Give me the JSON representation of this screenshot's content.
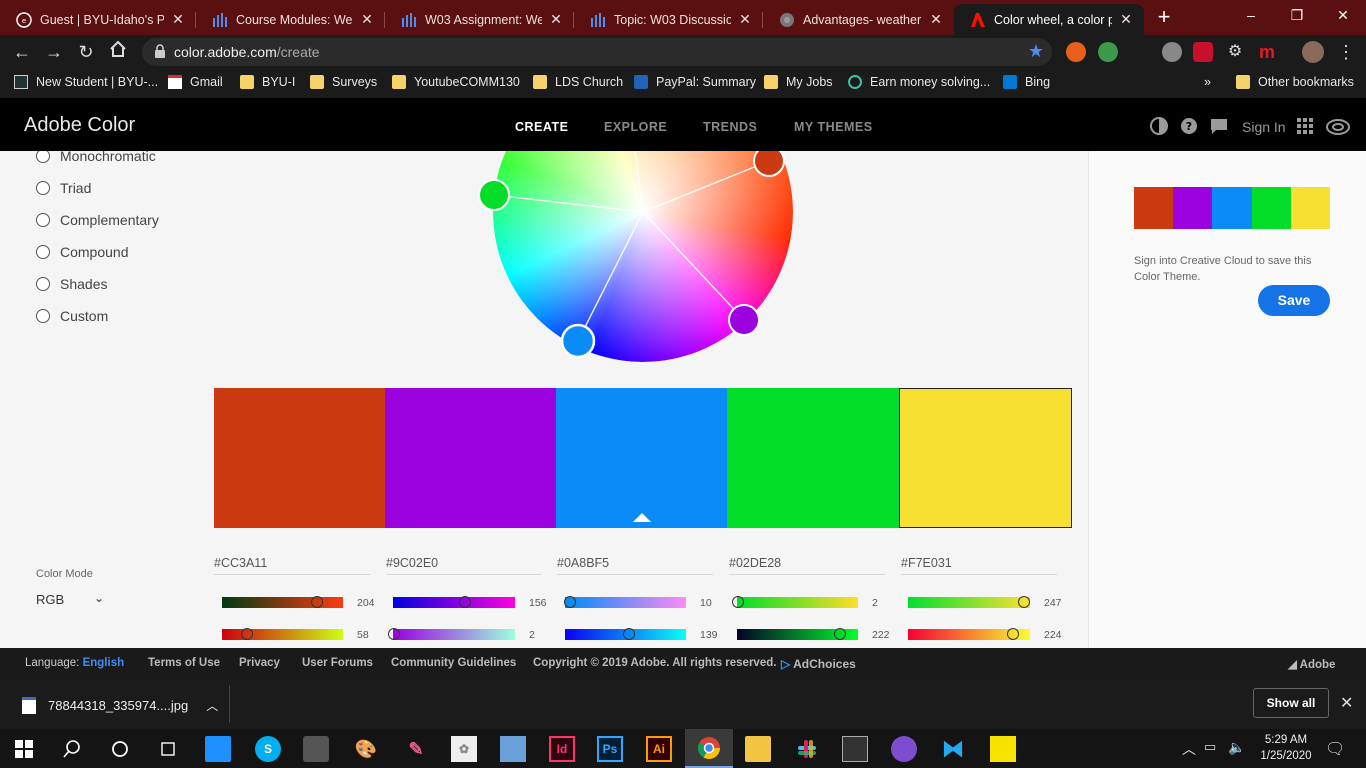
{
  "browser": {
    "tabs": [
      {
        "title": "Guest | BYU-Idaho's Per",
        "icon": "byui-icon"
      },
      {
        "title": "Course Modules: Web F",
        "icon": "canvas-icon"
      },
      {
        "title": "W03 Assignment: Webs",
        "icon": "canvas-icon"
      },
      {
        "title": "Topic: W03 Discussion: ",
        "icon": "canvas-icon"
      },
      {
        "title": "Advantages- weather",
        "icon": "globe-icon"
      },
      {
        "title": "Color wheel, a color pal",
        "icon": "adobe-icon"
      }
    ],
    "url_domain": "color.adobe.com",
    "url_path": "/create",
    "bookmarks": [
      {
        "label": "New Student | BYU-...",
        "icon": "byui-icon"
      },
      {
        "label": "Gmail",
        "icon": "gmail-icon"
      },
      {
        "label": "BYU-I",
        "icon": "folder-icon"
      },
      {
        "label": "Surveys",
        "icon": "folder-icon"
      },
      {
        "label": "YoutubeCOMM130",
        "icon": "folder-icon"
      },
      {
        "label": "LDS Church",
        "icon": "folder-icon"
      },
      {
        "label": "PayPal: Summary",
        "icon": "paypal-icon"
      },
      {
        "label": "My Jobs",
        "icon": "folder-icon"
      },
      {
        "label": "Earn money solving...",
        "icon": "chegg-icon"
      },
      {
        "label": "Bing",
        "icon": "bing-icon"
      }
    ],
    "bookmarks_overflow": "»",
    "other_bookmarks": "Other bookmarks"
  },
  "header": {
    "brand": "Adobe Color",
    "nav": [
      "CREATE",
      "EXPLORE",
      "TRENDS",
      "MY THEMES"
    ],
    "active_nav": "CREATE",
    "sign_in": "Sign In"
  },
  "harmony_rules": [
    "Monochromatic",
    "Triad",
    "Complementary",
    "Compound",
    "Shades",
    "Custom"
  ],
  "theme": {
    "colors": [
      "#CC3A11",
      "#9C02E0",
      "#0A8BF5",
      "#02DE28",
      "#F7E031"
    ],
    "selected_index": 2
  },
  "save_panel": {
    "note": "Sign into Creative Cloud to save this Color Theme.",
    "save_label": "Save"
  },
  "color_mode": {
    "label": "Color Mode",
    "value": "RGB"
  },
  "rgb_rows": [
    [
      204,
      156,
      10,
      2,
      247
    ],
    [
      58,
      2,
      139,
      222,
      224
    ]
  ],
  "footer": {
    "language_label": "Language:",
    "language_value": "English",
    "links": [
      "Terms of Use",
      "Privacy",
      "User Forums",
      "Community Guidelines"
    ],
    "copyright": "Copyright © 2019 Adobe. All rights reserved.",
    "adchoices": "AdChoices",
    "adobe": "Adobe"
  },
  "download": {
    "filename": "78844318_335974....jpg",
    "show_all": "Show all"
  },
  "taskbar": {
    "time": "5:29 AM",
    "date": "1/25/2020"
  }
}
